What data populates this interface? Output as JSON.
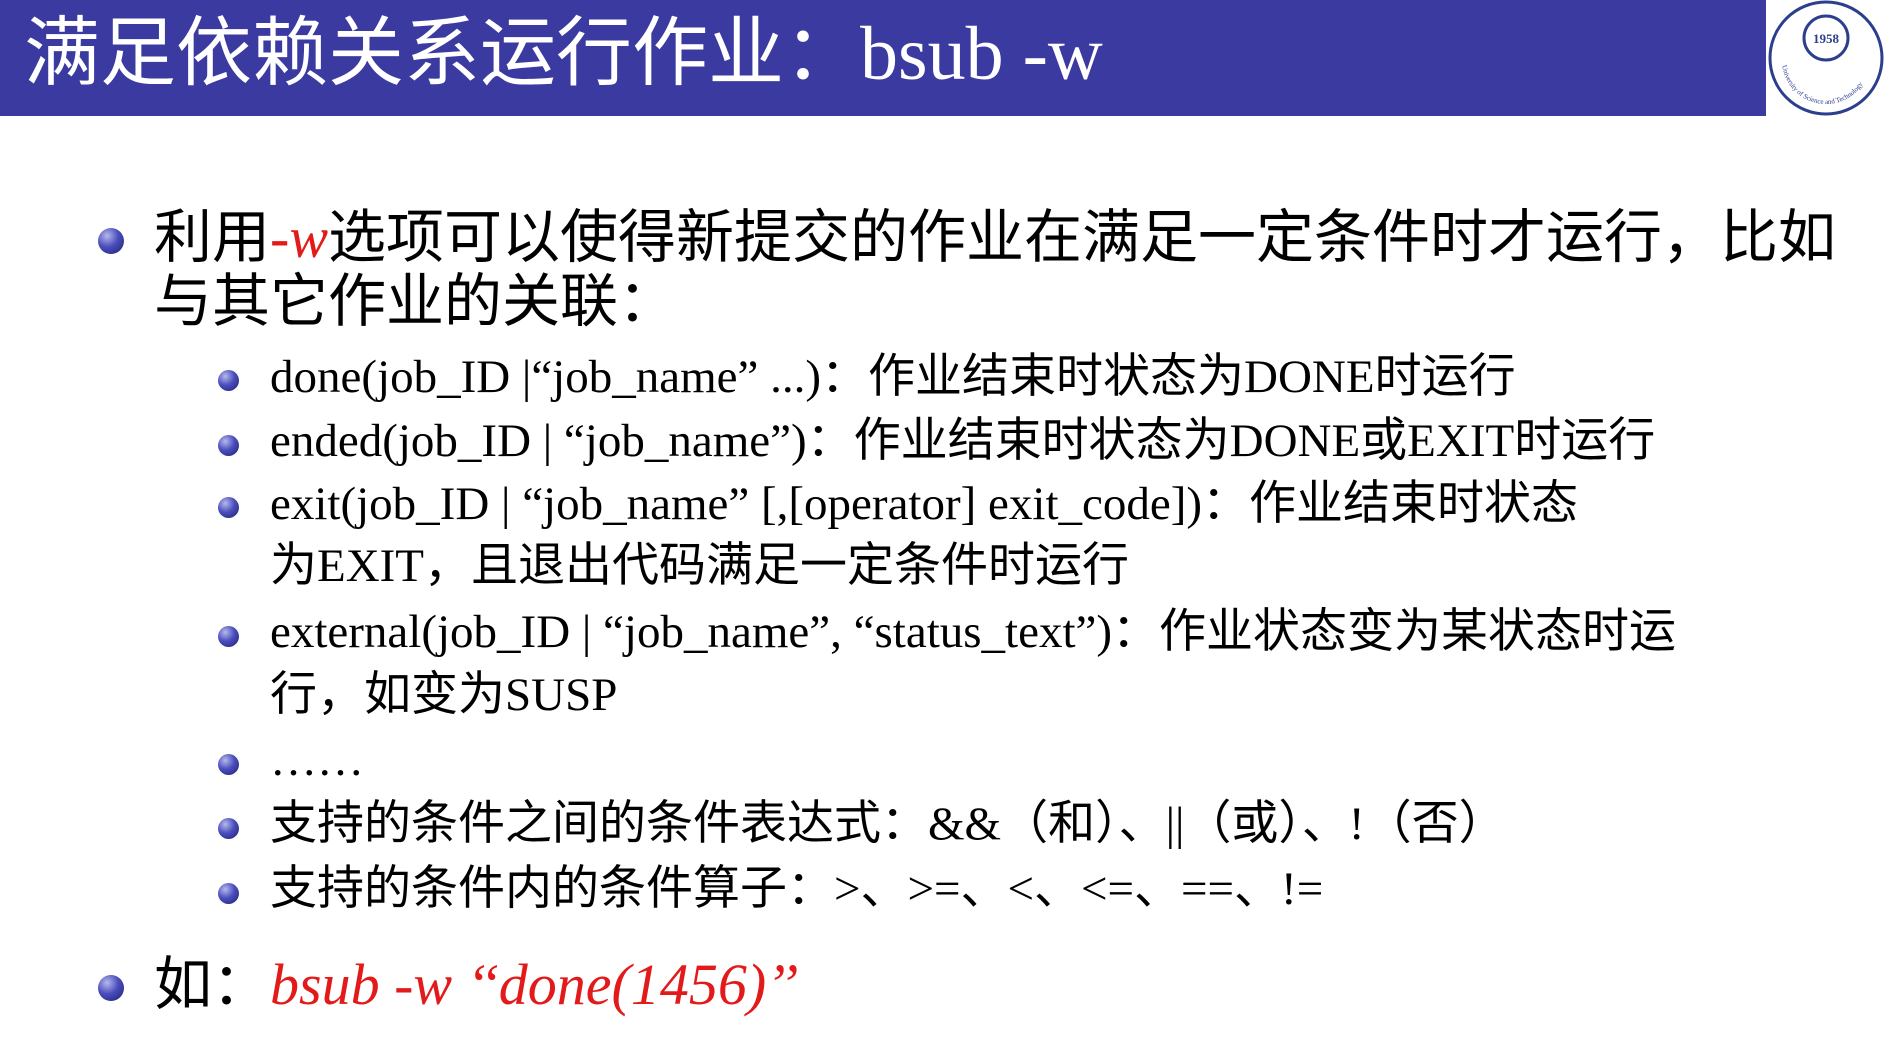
{
  "header": {
    "title": "满足依赖关系运行作业：bsub -w"
  },
  "logo": {
    "year": "1958",
    "text": "University of Science and Technology"
  },
  "intro": {
    "prefix": "利用",
    "option": "-w",
    "line1_rest": "选项可以使得新提交的作业在满足一定条件时才运行，比如",
    "line2": "与其它作业的关联："
  },
  "conditions": [
    {
      "line1": "done(job_ID |“job_name” ...)：作业结束时状态为DONE时运行"
    },
    {
      "line1": "ended(job_ID | “job_name”)：作业结束时状态为DONE或EXIT时运行"
    },
    {
      "line1": "exit(job_ID | “job_name” [,[operator] exit_code])：作业结束时状态",
      "line2": "为EXIT，且退出代码满足一定条件时运行"
    },
    {
      "line1": "external(job_ID | “job_name”, “status_text”)：作业状态变为某状态时运",
      "line2": "行，如变为SUSP"
    },
    {
      "line1": "……"
    },
    {
      "line1": "支持的条件之间的条件表达式：&&（和）、||（或）、!（否）"
    },
    {
      "line1": "支持的条件内的条件算子：>、>=、<、<=、==、!="
    }
  ],
  "example": {
    "label": "如：",
    "command": "bsub -w ‘‘done(1456)’’"
  },
  "colors": {
    "header_bg": "#3a3aa0",
    "accent_red": "#e21a1a",
    "bullet": "#2e318f"
  }
}
